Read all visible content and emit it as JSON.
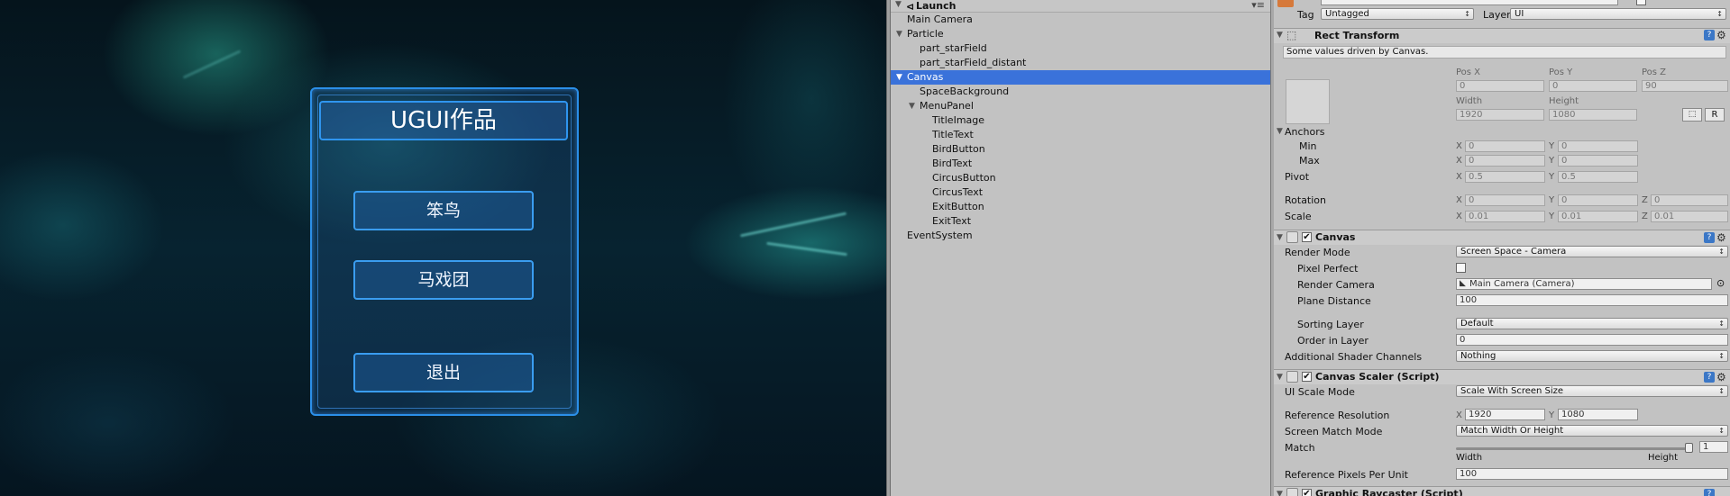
{
  "game": {
    "title": "UGUI作品",
    "buttons": [
      "笨鸟",
      "马戏团",
      "退出"
    ]
  },
  "hierarchy": {
    "scene": "Launch",
    "items": [
      {
        "label": "Main Camera",
        "depth": 1,
        "expand": false,
        "selected": false
      },
      {
        "label": "Particle",
        "depth": 1,
        "expand": true,
        "selected": false
      },
      {
        "label": "part_starField",
        "depth": 2,
        "expand": false,
        "selected": false
      },
      {
        "label": "part_starField_distant",
        "depth": 2,
        "expand": false,
        "selected": false
      },
      {
        "label": "Canvas",
        "depth": 1,
        "expand": true,
        "selected": true
      },
      {
        "label": "SpaceBackground",
        "depth": 2,
        "expand": false,
        "selected": false
      },
      {
        "label": "MenuPanel",
        "depth": 2,
        "expand": true,
        "selected": false
      },
      {
        "label": "TitleImage",
        "depth": 3,
        "expand": false,
        "selected": false
      },
      {
        "label": "TitleText",
        "depth": 3,
        "expand": false,
        "selected": false
      },
      {
        "label": "BirdButton",
        "depth": 3,
        "expand": false,
        "selected": false
      },
      {
        "label": "BirdText",
        "depth": 3,
        "expand": false,
        "selected": false
      },
      {
        "label": "CircusButton",
        "depth": 3,
        "expand": false,
        "selected": false
      },
      {
        "label": "CircusText",
        "depth": 3,
        "expand": false,
        "selected": false
      },
      {
        "label": "ExitButton",
        "depth": 3,
        "expand": false,
        "selected": false
      },
      {
        "label": "ExitText",
        "depth": 3,
        "expand": false,
        "selected": false
      },
      {
        "label": "EventSystem",
        "depth": 1,
        "expand": false,
        "selected": false
      }
    ]
  },
  "inspector": {
    "tag_label": "Tag",
    "tag_value": "Untagged",
    "layer_label": "Layer",
    "layer_value": "UI",
    "rect": {
      "title": "Rect Transform",
      "note": "Some values driven by Canvas.",
      "pos_x_label": "Pos X",
      "pos_y_label": "Pos Y",
      "pos_z_label": "Pos Z",
      "pos_x": "0",
      "pos_y": "0",
      "pos_z": "90",
      "width_label": "Width",
      "height_label": "Height",
      "width": "1920",
      "height": "1080",
      "r_btn": "R",
      "anchors": "Anchors",
      "min": "Min",
      "max": "Max",
      "pivot": "Pivot",
      "min_x": "0",
      "min_y": "0",
      "max_x": "0",
      "max_y": "0",
      "pivot_x": "0.5",
      "pivot_y": "0.5",
      "rotation": "Rotation",
      "scale": "Scale",
      "rot_x": "0",
      "rot_y": "0",
      "rot_z": "0",
      "scale_x": "0.01",
      "scale_y": "0.01",
      "scale_z": "0.01",
      "x": "X",
      "y": "Y",
      "z": "Z"
    },
    "canvas": {
      "title": "Canvas",
      "render_mode_label": "Render Mode",
      "render_mode": "Screen Space - Camera",
      "pixel_perfect_label": "Pixel Perfect",
      "render_camera_label": "Render Camera",
      "render_camera": "Main Camera (Camera)",
      "plane_distance_label": "Plane Distance",
      "plane_distance": "100",
      "sorting_layer_label": "Sorting Layer",
      "sorting_layer": "Default",
      "order_label": "Order in Layer",
      "order": "0",
      "shader_label": "Additional Shader Channels",
      "shader": "Nothing"
    },
    "scaler": {
      "title": "Canvas Scaler (Script)",
      "ui_scale_label": "UI Scale Mode",
      "ui_scale": "Scale With Screen Size",
      "ref_res_label": "Reference Resolution",
      "ref_x": "1920",
      "ref_y": "1080",
      "match_mode_label": "Screen Match Mode",
      "match_mode": "Match Width Or Height",
      "match_label": "Match",
      "match_value": "1",
      "match_fraction": 1,
      "width_label": "Width",
      "height_label": "Height",
      "ppu_label": "Reference Pixels Per Unit",
      "ppu": "100"
    },
    "raycaster": {
      "title": "Graphic Raycaster (Script)"
    }
  }
}
